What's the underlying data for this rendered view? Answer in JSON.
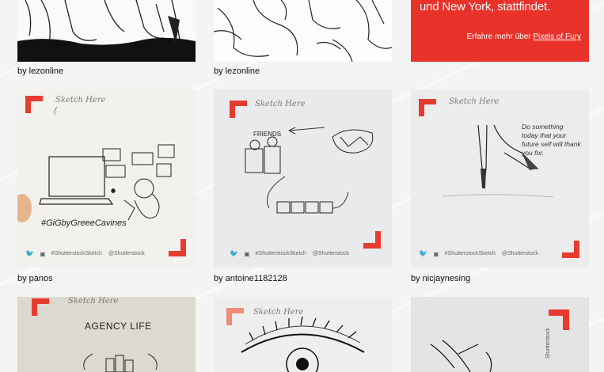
{
  "promo": {
    "headline": "und New York, stattfindet.",
    "more_prefix": "Erfahre mehr über",
    "more_link": "Pixels of Fury"
  },
  "card_text": {
    "sketch_here": "Sketch Here",
    "hashtag": "#ShutterstockSketch",
    "handle": "@Shutterstock"
  },
  "row1": {
    "tile1_author": "by lezonline",
    "tile2_author": "by lezonline"
  },
  "row2": {
    "tile1_author": "by panos",
    "tile1_drawing_text": "#GiGbyGreeeCavines",
    "tile2_author": "by antoine1182128",
    "tile2_drawing_text": "FRIENDS",
    "tile3_author": "by nicjaynesing",
    "tile3_drawing_text": "Do something today that your future self will thank you for."
  },
  "row3": {
    "tile1_drawing_text": "AGENCY LIFE",
    "tile3_side_text": "Shutterstock"
  },
  "colors": {
    "brand_red": "#e63c30",
    "promo_bg": "#e8322a",
    "page_bg": "#f4f4f4"
  }
}
